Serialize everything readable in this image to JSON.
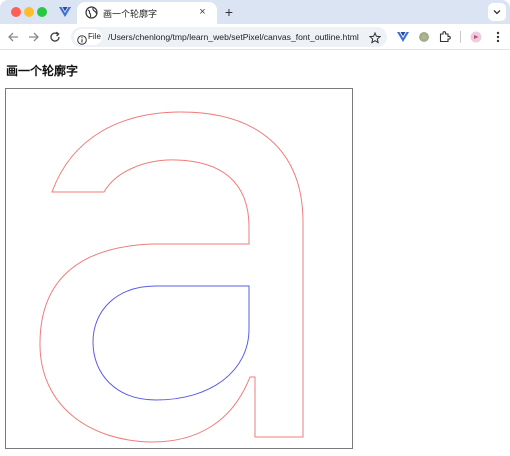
{
  "browser": {
    "tab": {
      "title": "画一个轮廓字",
      "close_glyph": "×"
    },
    "new_tab_glyph": "+",
    "address": {
      "chip_label": "File",
      "url": "/Users/chenlong/tmp/learn_web/setPixel/canvas_font_outline.html"
    },
    "icons": {
      "back": "arrow-left",
      "forward": "arrow-right",
      "reload": "reload",
      "info": "info-circle",
      "bookmark": "star-outline",
      "extensions": [
        "v-extension",
        "green-circle-extension",
        "puzzle-extensions",
        "pink-avatar-extension"
      ],
      "menu": "three-dot-menu"
    }
  },
  "page": {
    "heading": "画一个轮廓字",
    "canvas": {
      "glyph": "a",
      "outer_stroke": "#f07b7b",
      "counter_stroke": "#5b5be6",
      "border_color": "#7a7a7a"
    }
  }
}
